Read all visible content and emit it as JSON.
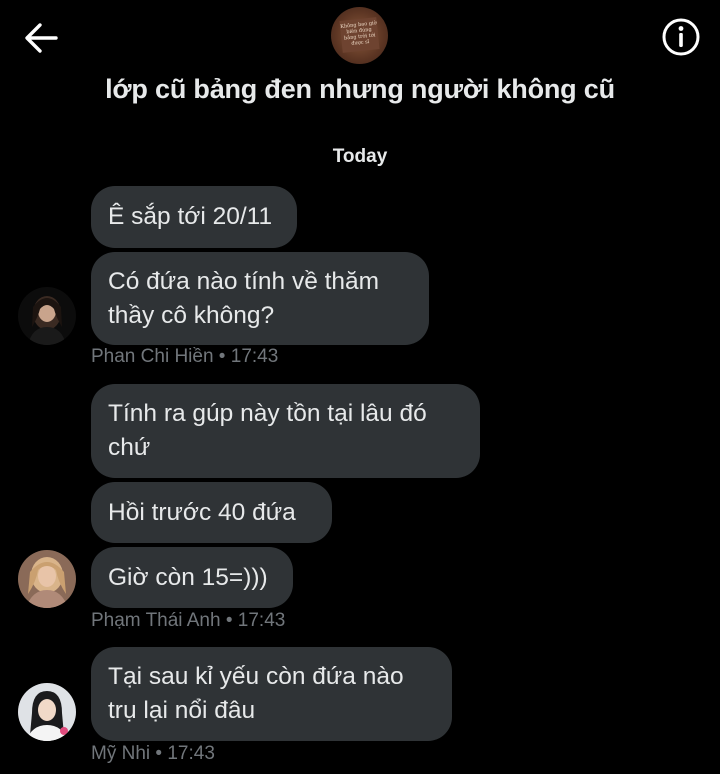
{
  "header": {
    "title": "lớp cũ bảng đen nhưng người không cũ",
    "back_icon": "arrow-left-icon",
    "info_icon": "info-icon",
    "group_avatar_text": "Không bao giờ biên đúng bảng\ntrời tới được sĩ"
  },
  "date_divider": "Today",
  "messages": [
    {
      "sender": "Phan Chi Hiền",
      "time": "17:43",
      "bubbles": [
        "Ê sắp tới 20/11",
        "Có đứa nào tính về thăm\nthầy cô không?"
      ]
    },
    {
      "sender": "Phạm Thái Anh",
      "time": "17:43",
      "bubbles": [
        "Tính ra gúp này tồn tại lâu đó\nchứ",
        "Hồi trước 40 đứa",
        "Giờ còn 15=)))"
      ]
    },
    {
      "sender": "Mỹ Nhi",
      "time": "17:43",
      "bubbles": [
        "Tại sau kỉ yếu còn đứa nào\ntrụ lại nổi đâu"
      ]
    }
  ],
  "meta_separator": " • ",
  "colors": {
    "background": "#000000",
    "bubble": "#2f3336",
    "text": "#e7e9ea",
    "meta": "#71767b"
  }
}
